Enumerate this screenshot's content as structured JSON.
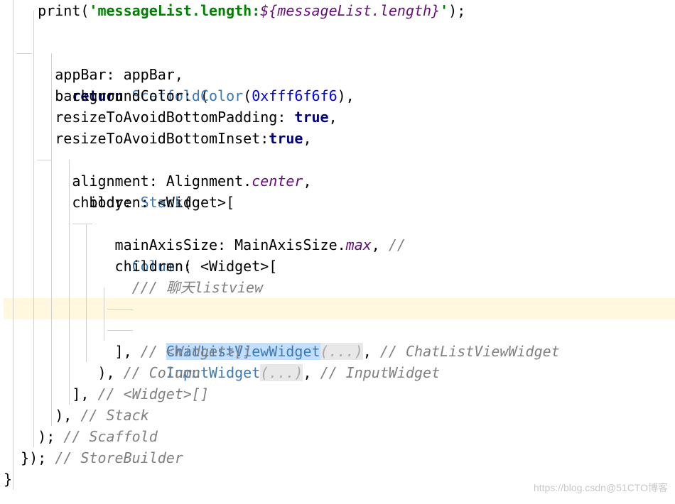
{
  "code": {
    "l1_print": "print(",
    "l1_str_a": "'messageList.length:",
    "l1_interp": "${messageList.length}",
    "l1_str_b": "'",
    "l1_end": ");",
    "l3_return": "return",
    "l3_scaffold": "Scaffold",
    "l3_paren": "(",
    "l4_appbar": "appBar: appBar,",
    "l5_bg_a": "backgroundColor: ",
    "l5_color": "Color",
    "l5_bg_b": "(",
    "l5_hex": "0xfff6f6f6",
    "l5_bg_c": "),",
    "l6_a": "resizeToAvoidBottomPadding: ",
    "l6_true": "true",
    "l6_b": ",",
    "l7_a": "resizeToAvoidBottomInset:",
    "l7_true": "true",
    "l7_b": ",",
    "l8_a": "body: ",
    "l8_stack": "Stack",
    "l8_b": "(",
    "l9_a": "alignment: Alignment.",
    "l9_center": "center",
    "l9_b": ",",
    "l10_a": "children: <Widget>[",
    "l11_col": "Column",
    "l11_b": "(",
    "l12_a": "mainAxisSize: MainAxisSize.",
    "l12_max": "max",
    "l12_b": ", ",
    "l12_c": "//",
    "l13_a": "children: <Widget>[",
    "l14_comment": "/// 聊天listview",
    "l15_widget": "ChatListViewWidget",
    "l15_fold": "(...)",
    "l15_b": ", ",
    "l15_c": "// ChatListViewWidget",
    "l16_widget": "InputWidget",
    "l16_fold": "(...)",
    "l16_b": ", ",
    "l16_c": "// InputWidget",
    "l17_a": "], ",
    "l17_c": "// <Widget>[]",
    "l18_a": "), ",
    "l18_c": "// Column",
    "l19_a": "], ",
    "l19_c": "// <Widget>[]",
    "l20_a": "), ",
    "l20_c": "// Stack",
    "l21_a": "); ",
    "l21_c": "// Scaffold",
    "l22_a": "}); ",
    "l22_c": "// StoreBuilder",
    "l23_a": "}"
  },
  "watermark": "https://blog.csdn@51CTO博客"
}
